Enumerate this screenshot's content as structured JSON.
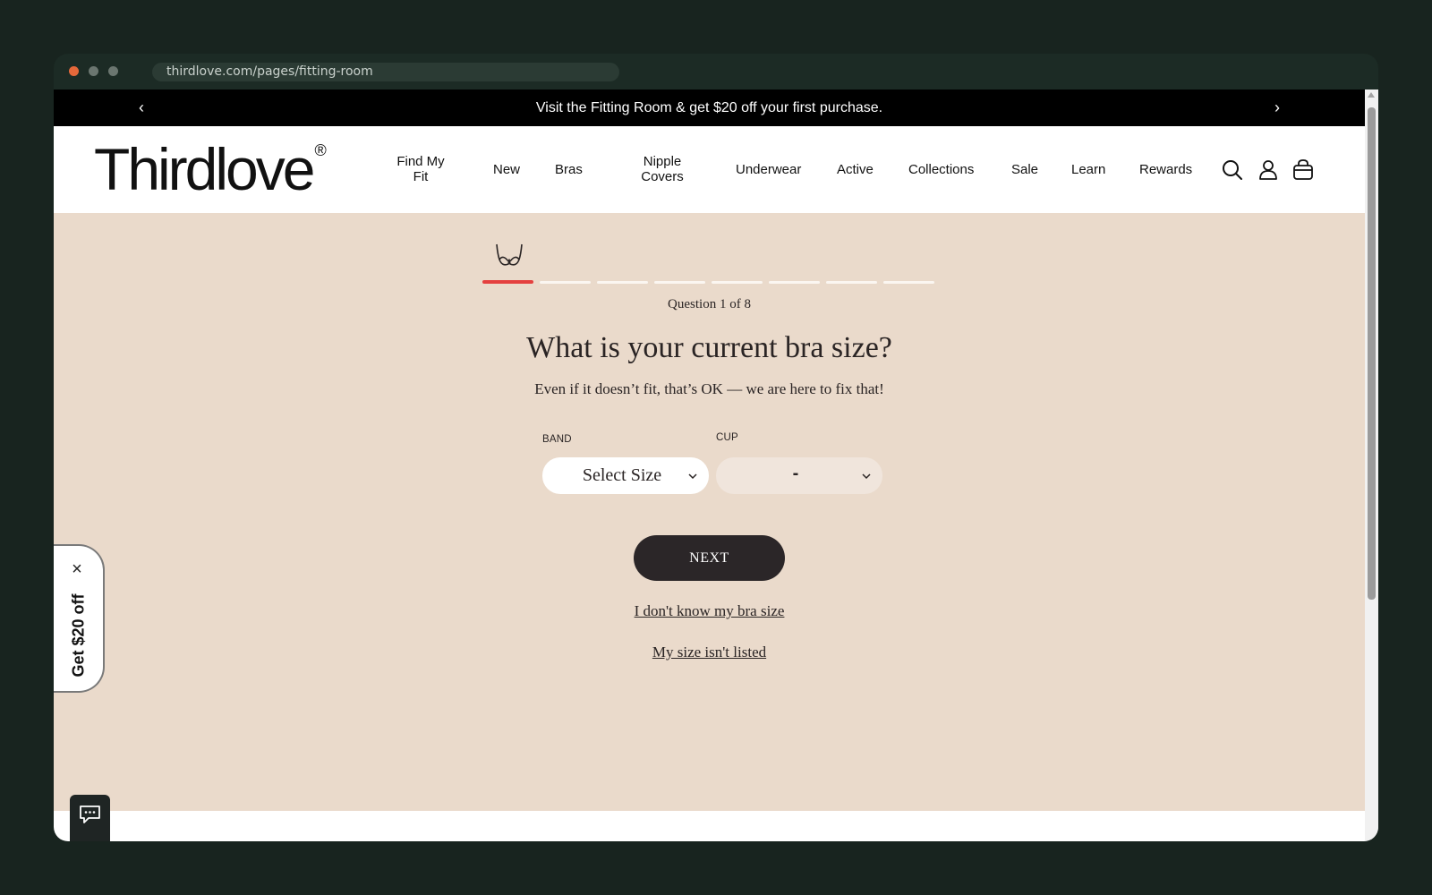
{
  "browser": {
    "url": "thirdlove.com/pages/fitting-room"
  },
  "announcement": {
    "prev": "‹",
    "message": "Visit the Fitting Room & get $20 off your first purchase.",
    "next": "›"
  },
  "header": {
    "logo": "Thirdlove",
    "logo_mark": "®",
    "nav": {
      "find_my_fit": "Find My Fit",
      "new": "New",
      "bras": "Bras",
      "nipple_covers": "Nipple Covers",
      "underwear": "Underwear",
      "active": "Active",
      "collections": "Collections",
      "sale": "Sale",
      "learn": "Learn",
      "rewards": "Rewards"
    },
    "icons": [
      "search-icon",
      "account-icon",
      "cart-icon"
    ]
  },
  "quiz": {
    "progress": {
      "current": 1,
      "total": 8
    },
    "counter": "Question 1 of 8",
    "title": "What is your current bra size?",
    "subtitle": "Even if it doesn’t fit, that’s OK — we are here to fix that!",
    "band": {
      "label": "BAND",
      "value": "Select Size"
    },
    "cup": {
      "label": "CUP",
      "value": "-"
    },
    "next_label": "NEXT",
    "link_unknown": "I don't know my bra size",
    "link_not_listed": "My size isn't listed"
  },
  "promo": {
    "close": "×",
    "label": "Get $20 off"
  },
  "colors": {
    "page_bg": "#eadacb",
    "accent": "#e4403f",
    "button": "#2b2628"
  }
}
